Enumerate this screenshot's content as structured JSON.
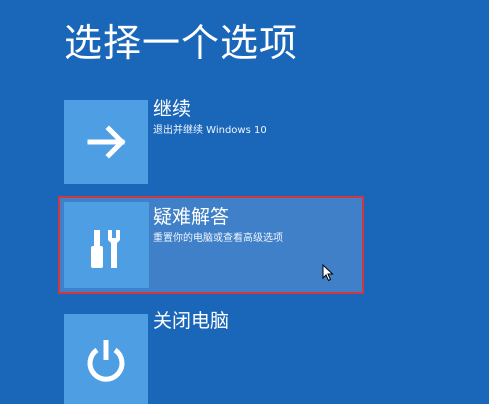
{
  "page": {
    "title": "选择一个选项",
    "background_color": "#1a66b8",
    "tile_color": "#4d9ee2",
    "selected_color": "#3f80c8",
    "highlight_border_color": "#d0383f"
  },
  "options": [
    {
      "title": "继续",
      "description": "退出并继续 Windows 10",
      "icon": "arrow-right-icon"
    },
    {
      "title": "疑难解答",
      "description": "重置你的电脑或查看高级选项",
      "icon": "tools-icon",
      "selected": true
    },
    {
      "title": "关闭电脑",
      "description": "",
      "icon": "power-icon"
    }
  ],
  "cursor": {
    "icon": "mouse-pointer-icon"
  }
}
